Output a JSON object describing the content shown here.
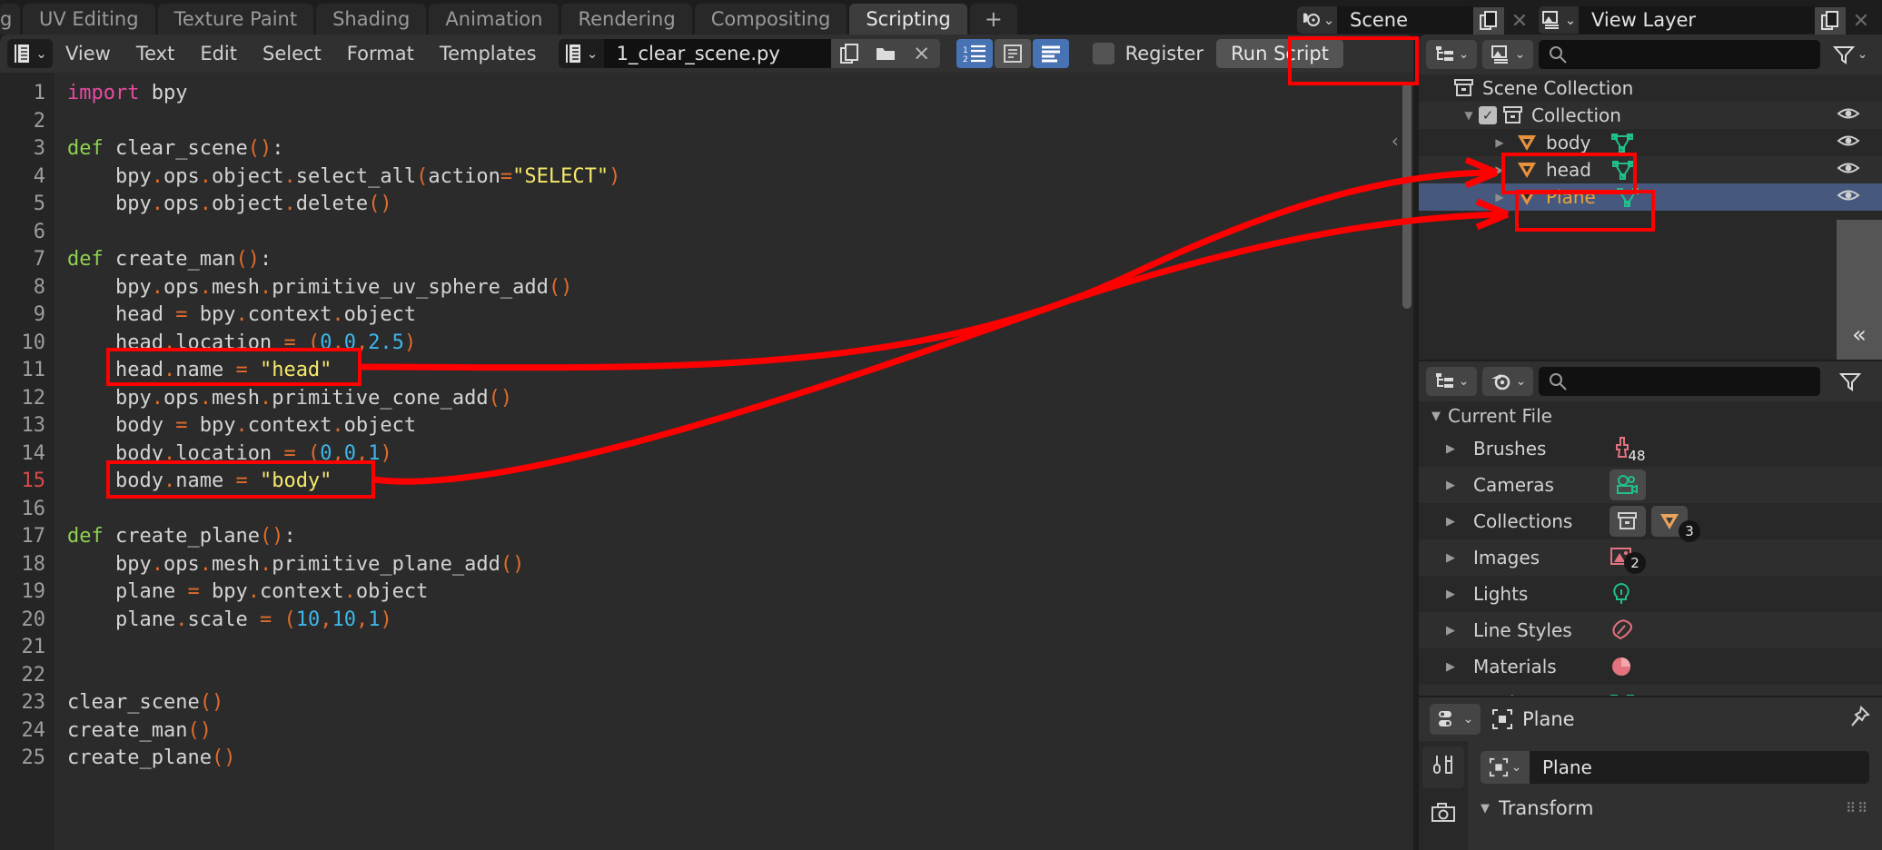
{
  "app": {
    "workspace_tabs": [
      {
        "label": "g",
        "active": false,
        "clipped": true
      },
      {
        "label": "UV Editing",
        "active": false
      },
      {
        "label": "Texture Paint",
        "active": false
      },
      {
        "label": "Shading",
        "active": false
      },
      {
        "label": "Animation",
        "active": false
      },
      {
        "label": "Rendering",
        "active": false
      },
      {
        "label": "Compositing",
        "active": false
      },
      {
        "label": "Scripting",
        "active": true
      }
    ],
    "add_workspace_label": "+",
    "scene_field": {
      "value": "Scene",
      "icon": "scene-icon"
    },
    "view_layer_field": {
      "value": "View Layer",
      "icon": "view-layer-icon"
    }
  },
  "text_editor": {
    "editor_type_icon": "text-editor-icon",
    "menus": [
      "View",
      "Text",
      "Edit",
      "Select",
      "Format",
      "Templates"
    ],
    "file": {
      "name": "1_clear_scene.py",
      "datablock_icon": "text-datablock-icon",
      "new_label": "new-text-icon",
      "open_label": "open-text-icon",
      "unlink_label": "×"
    },
    "toggles": [
      {
        "name": "line-numbers",
        "on": true
      },
      {
        "name": "word-wrap",
        "on": false
      },
      {
        "name": "syntax-highlight",
        "on": true
      }
    ],
    "register": {
      "label": "Register",
      "checked": false
    },
    "run_script": {
      "label": "Run Script"
    },
    "cursor_line": 15,
    "code": [
      {
        "n": 1,
        "tokens": [
          {
            "t": "import",
            "c": "kw"
          },
          {
            "t": " bpy",
            "c": ""
          }
        ]
      },
      {
        "n": 2,
        "tokens": []
      },
      {
        "n": 3,
        "tokens": [
          {
            "t": "def",
            "c": "kwd"
          },
          {
            "t": " clear_scene",
            "c": ""
          },
          {
            "t": "()",
            "c": "par"
          },
          {
            "t": ":",
            "c": ""
          }
        ]
      },
      {
        "n": 4,
        "tokens": [
          {
            "t": "    bpy",
            "c": ""
          },
          {
            "t": ".",
            "c": "par"
          },
          {
            "t": "ops",
            "c": ""
          },
          {
            "t": ".",
            "c": "par"
          },
          {
            "t": "object",
            "c": ""
          },
          {
            "t": ".",
            "c": "par"
          },
          {
            "t": "select_all",
            "c": ""
          },
          {
            "t": "(",
            "c": "par"
          },
          {
            "t": "action",
            "c": ""
          },
          {
            "t": "=",
            "c": "op"
          },
          {
            "t": "\"SELECT\"",
            "c": "str"
          },
          {
            "t": ")",
            "c": "par"
          }
        ]
      },
      {
        "n": 5,
        "tokens": [
          {
            "t": "    bpy",
            "c": ""
          },
          {
            "t": ".",
            "c": "par"
          },
          {
            "t": "ops",
            "c": ""
          },
          {
            "t": ".",
            "c": "par"
          },
          {
            "t": "object",
            "c": ""
          },
          {
            "t": ".",
            "c": "par"
          },
          {
            "t": "delete",
            "c": ""
          },
          {
            "t": "()",
            "c": "par"
          }
        ]
      },
      {
        "n": 6,
        "tokens": []
      },
      {
        "n": 7,
        "tokens": [
          {
            "t": "def",
            "c": "kwd"
          },
          {
            "t": " create_man",
            "c": ""
          },
          {
            "t": "()",
            "c": "par"
          },
          {
            "t": ":",
            "c": ""
          }
        ]
      },
      {
        "n": 8,
        "tokens": [
          {
            "t": "    bpy",
            "c": ""
          },
          {
            "t": ".",
            "c": "par"
          },
          {
            "t": "ops",
            "c": ""
          },
          {
            "t": ".",
            "c": "par"
          },
          {
            "t": "mesh",
            "c": ""
          },
          {
            "t": ".",
            "c": "par"
          },
          {
            "t": "primitive_uv_sphere_add",
            "c": ""
          },
          {
            "t": "()",
            "c": "par"
          }
        ]
      },
      {
        "n": 9,
        "tokens": [
          {
            "t": "    head ",
            "c": ""
          },
          {
            "t": "=",
            "c": "op"
          },
          {
            "t": " bpy",
            "c": ""
          },
          {
            "t": ".",
            "c": "par"
          },
          {
            "t": "context",
            "c": ""
          },
          {
            "t": ".",
            "c": "par"
          },
          {
            "t": "object",
            "c": ""
          }
        ]
      },
      {
        "n": 10,
        "tokens": [
          {
            "t": "    head",
            "c": ""
          },
          {
            "t": ".",
            "c": "par"
          },
          {
            "t": "location ",
            "c": ""
          },
          {
            "t": "=",
            "c": "op"
          },
          {
            "t": " ",
            "c": ""
          },
          {
            "t": "(",
            "c": "par"
          },
          {
            "t": "0",
            "c": "num"
          },
          {
            "t": ",",
            "c": "par"
          },
          {
            "t": "0",
            "c": "num"
          },
          {
            "t": ",",
            "c": "par"
          },
          {
            "t": "2.5",
            "c": "num"
          },
          {
            "t": ")",
            "c": "par"
          }
        ]
      },
      {
        "n": 11,
        "tokens": [
          {
            "t": "    head",
            "c": ""
          },
          {
            "t": ".",
            "c": "par"
          },
          {
            "t": "name ",
            "c": ""
          },
          {
            "t": "=",
            "c": "op"
          },
          {
            "t": " ",
            "c": ""
          },
          {
            "t": "\"head\"",
            "c": "str"
          }
        ]
      },
      {
        "n": 12,
        "tokens": [
          {
            "t": "    bpy",
            "c": ""
          },
          {
            "t": ".",
            "c": "par"
          },
          {
            "t": "ops",
            "c": ""
          },
          {
            "t": ".",
            "c": "par"
          },
          {
            "t": "mesh",
            "c": ""
          },
          {
            "t": ".",
            "c": "par"
          },
          {
            "t": "primitive_cone_add",
            "c": ""
          },
          {
            "t": "()",
            "c": "par"
          }
        ]
      },
      {
        "n": 13,
        "tokens": [
          {
            "t": "    body ",
            "c": ""
          },
          {
            "t": "=",
            "c": "op"
          },
          {
            "t": " bpy",
            "c": ""
          },
          {
            "t": ".",
            "c": "par"
          },
          {
            "t": "context",
            "c": ""
          },
          {
            "t": ".",
            "c": "par"
          },
          {
            "t": "object",
            "c": ""
          }
        ]
      },
      {
        "n": 14,
        "tokens": [
          {
            "t": "    body",
            "c": ""
          },
          {
            "t": ".",
            "c": "par"
          },
          {
            "t": "location ",
            "c": ""
          },
          {
            "t": "=",
            "c": "op"
          },
          {
            "t": " ",
            "c": ""
          },
          {
            "t": "(",
            "c": "par"
          },
          {
            "t": "0",
            "c": "num"
          },
          {
            "t": ",",
            "c": "par"
          },
          {
            "t": "0",
            "c": "num"
          },
          {
            "t": ",",
            "c": "par"
          },
          {
            "t": "1",
            "c": "num"
          },
          {
            "t": ")",
            "c": "par"
          }
        ]
      },
      {
        "n": 15,
        "tokens": [
          {
            "t": "    body",
            "c": ""
          },
          {
            "t": ".",
            "c": "par"
          },
          {
            "t": "name ",
            "c": ""
          },
          {
            "t": "=",
            "c": "op"
          },
          {
            "t": " ",
            "c": ""
          },
          {
            "t": "\"body\"",
            "c": "str"
          }
        ]
      },
      {
        "n": 16,
        "tokens": []
      },
      {
        "n": 17,
        "tokens": [
          {
            "t": "def",
            "c": "kwd"
          },
          {
            "t": " create_plane",
            "c": ""
          },
          {
            "t": "()",
            "c": "par"
          },
          {
            "t": ":",
            "c": ""
          }
        ]
      },
      {
        "n": 18,
        "tokens": [
          {
            "t": "    bpy",
            "c": ""
          },
          {
            "t": ".",
            "c": "par"
          },
          {
            "t": "ops",
            "c": ""
          },
          {
            "t": ".",
            "c": "par"
          },
          {
            "t": "mesh",
            "c": ""
          },
          {
            "t": ".",
            "c": "par"
          },
          {
            "t": "primitive_plane_add",
            "c": ""
          },
          {
            "t": "()",
            "c": "par"
          }
        ]
      },
      {
        "n": 19,
        "tokens": [
          {
            "t": "    plane ",
            "c": ""
          },
          {
            "t": "=",
            "c": "op"
          },
          {
            "t": " bpy",
            "c": ""
          },
          {
            "t": ".",
            "c": "par"
          },
          {
            "t": "context",
            "c": ""
          },
          {
            "t": ".",
            "c": "par"
          },
          {
            "t": "object",
            "c": ""
          }
        ]
      },
      {
        "n": 20,
        "tokens": [
          {
            "t": "    plane",
            "c": ""
          },
          {
            "t": ".",
            "c": "par"
          },
          {
            "t": "scale ",
            "c": ""
          },
          {
            "t": "=",
            "c": "op"
          },
          {
            "t": " ",
            "c": ""
          },
          {
            "t": "(",
            "c": "par"
          },
          {
            "t": "10",
            "c": "num"
          },
          {
            "t": ",",
            "c": "par"
          },
          {
            "t": "10",
            "c": "num"
          },
          {
            "t": ",",
            "c": "par"
          },
          {
            "t": "1",
            "c": "num"
          },
          {
            "t": ")",
            "c": "par"
          }
        ]
      },
      {
        "n": 21,
        "tokens": []
      },
      {
        "n": 22,
        "tokens": []
      },
      {
        "n": 23,
        "tokens": [
          {
            "t": "clear_scene",
            "c": ""
          },
          {
            "t": "()",
            "c": "par"
          }
        ]
      },
      {
        "n": 24,
        "tokens": [
          {
            "t": "create_man",
            "c": ""
          },
          {
            "t": "()",
            "c": "par"
          }
        ]
      },
      {
        "n": 25,
        "tokens": [
          {
            "t": "create_plane",
            "c": ""
          },
          {
            "t": "()",
            "c": "par"
          }
        ]
      }
    ]
  },
  "outliner": {
    "display_mode_icon": "outliner-display-mode-icon",
    "view_layer_icon": "view-layer-icon",
    "search_placeholder": "",
    "filter_icon": "filter-icon",
    "collapse_label": "«",
    "rows": [
      {
        "label": "Scene Collection",
        "indent": 0,
        "icon": "collection-box-icon",
        "type": "scene-collection",
        "has_disclosure": false,
        "checkbox": false,
        "eye": false,
        "selected": false
      },
      {
        "label": "Collection",
        "indent": 1,
        "icon": "collection-box-icon",
        "type": "collection",
        "has_disclosure": true,
        "expanded": true,
        "checkbox": true,
        "eye": true,
        "selected": false
      },
      {
        "label": "body",
        "indent": 2,
        "icon": "mesh-object-icon",
        "type": "object",
        "has_disclosure": true,
        "expanded": false,
        "checkbox": false,
        "eye": true,
        "mesh_icon": true,
        "selected": false,
        "highlighted": true
      },
      {
        "label": "head",
        "indent": 2,
        "icon": "mesh-object-icon",
        "type": "object",
        "has_disclosure": true,
        "expanded": false,
        "checkbox": false,
        "eye": true,
        "mesh_icon": true,
        "selected": false,
        "highlighted": true
      },
      {
        "label": "Plane",
        "indent": 2,
        "icon": "mesh-object-icon",
        "type": "object",
        "has_disclosure": true,
        "expanded": false,
        "checkbox": false,
        "eye": true,
        "mesh_icon": true,
        "selected": true
      }
    ]
  },
  "blender_file": {
    "display_mode_icon": "outliner-display-mode-icon",
    "blender_icon": "blender-file-icon",
    "search_placeholder": "",
    "filter_icon": "filter-icon",
    "current_file_label": "Current File",
    "rows": [
      {
        "label": "Brushes",
        "icon": "brush-icon",
        "count": "48",
        "count_flat": true
      },
      {
        "label": "Cameras",
        "icon": "camera-data-icon",
        "count": "",
        "boxed": true
      },
      {
        "label": "Collections",
        "icon": "collection-box-icon",
        "second_icon": "mesh-object-icon",
        "count": "3",
        "boxed": true
      },
      {
        "label": "Images",
        "icon": "image-icon",
        "count": "2"
      },
      {
        "label": "Lights",
        "icon": "light-icon",
        "count": ""
      },
      {
        "label": "Line Styles",
        "icon": "line-style-icon",
        "count": ""
      },
      {
        "label": "Materials",
        "icon": "material-icon",
        "count": ""
      },
      {
        "label": "Meshes",
        "icon": "mesh-data-icon",
        "count": ""
      }
    ]
  },
  "properties": {
    "editor_icon": "properties-editor-icon",
    "breadcrumb": "Plane",
    "breadcrumb_icon": "object-properties-icon",
    "pin_icon": "pin-icon",
    "tabs": [
      {
        "name": "tool",
        "icon": "tool-icon",
        "active": true
      },
      {
        "name": "render",
        "icon": "render-camera-icon",
        "active": false
      }
    ],
    "object_name": "Plane",
    "object_name_icon": "object-properties-icon",
    "panels": [
      {
        "label": "Transform",
        "expanded": true
      }
    ]
  },
  "annotations": {
    "boxes": [
      {
        "name": "run-script-highlight"
      },
      {
        "name": "code-line-11-highlight"
      },
      {
        "name": "code-line-15-highlight"
      },
      {
        "name": "outliner-body-highlight"
      },
      {
        "name": "outliner-head-highlight"
      }
    ],
    "arrows": [
      {
        "name": "head-name-to-outliner-arrow"
      },
      {
        "name": "body-name-to-outliner-arrow"
      }
    ]
  }
}
